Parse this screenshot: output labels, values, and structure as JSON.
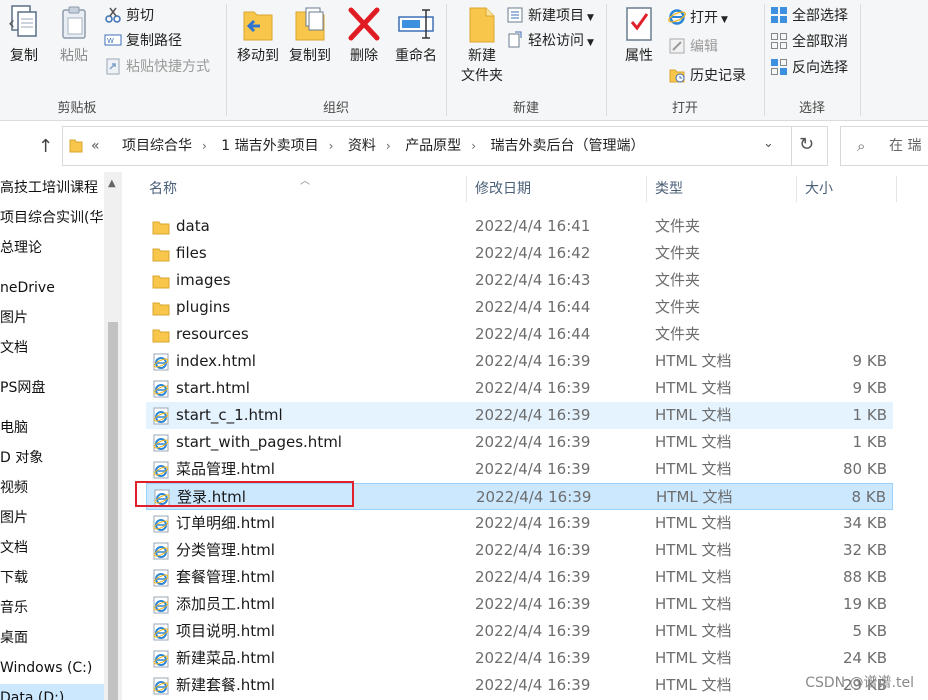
{
  "ribbon": {
    "clipboard": {
      "label": "剪贴板",
      "copy": "复制",
      "paste": "粘贴",
      "cut": "剪切",
      "copy_path": "复制路径",
      "paste_shortcut": "粘贴快捷方式"
    },
    "organize": {
      "label": "组织",
      "move_to": "移动到",
      "copy_to": "复制到",
      "delete": "删除",
      "rename": "重命名"
    },
    "new": {
      "label": "新建",
      "new_folder_1": "新建",
      "new_folder_2": "文件夹",
      "new_item": "新建项目",
      "easy_access": "轻松访问"
    },
    "open": {
      "label": "打开",
      "properties": "属性",
      "open": "打开",
      "edit": "编辑",
      "history": "历史记录"
    },
    "select": {
      "label": "选择",
      "select_all": "全部选择",
      "select_none": "全部取消",
      "invert": "反向选择"
    }
  },
  "address": {
    "overflow": "«",
    "crumbs": [
      "项目综合华",
      "1 瑞吉外卖项目",
      "资料",
      "产品原型",
      "瑞吉外卖后台（管理端）"
    ],
    "search_placeholder": "在 瑞"
  },
  "nav": {
    "items": [
      "高技工培训课程",
      "项目综合实训(华",
      "总理论",
      "neDrive",
      "图片",
      "文档",
      "PS网盘",
      "电脑",
      "D 对象",
      "视频",
      "图片",
      "文档",
      "下载",
      "音乐",
      "桌面",
      "Windows (C:)",
      "Data (D:)"
    ]
  },
  "columns": {
    "name": "名称",
    "date": "修改日期",
    "type": "类型",
    "size": "大小"
  },
  "files": [
    {
      "name": "data",
      "date": "2022/4/4 16:41",
      "type": "文件夹",
      "size": "",
      "kind": "folder"
    },
    {
      "name": "files",
      "date": "2022/4/4 16:42",
      "type": "文件夹",
      "size": "",
      "kind": "folder"
    },
    {
      "name": "images",
      "date": "2022/4/4 16:43",
      "type": "文件夹",
      "size": "",
      "kind": "folder"
    },
    {
      "name": "plugins",
      "date": "2022/4/4 16:44",
      "type": "文件夹",
      "size": "",
      "kind": "folder"
    },
    {
      "name": "resources",
      "date": "2022/4/4 16:44",
      "type": "文件夹",
      "size": "",
      "kind": "folder"
    },
    {
      "name": "index.html",
      "date": "2022/4/4 16:39",
      "type": "HTML 文档",
      "size": "9 KB",
      "kind": "html"
    },
    {
      "name": "start.html",
      "date": "2022/4/4 16:39",
      "type": "HTML 文档",
      "size": "9 KB",
      "kind": "html"
    },
    {
      "name": "start_c_1.html",
      "date": "2022/4/4 16:39",
      "type": "HTML 文档",
      "size": "1 KB",
      "kind": "html",
      "state": "hover"
    },
    {
      "name": "start_with_pages.html",
      "date": "2022/4/4 16:39",
      "type": "HTML 文档",
      "size": "1 KB",
      "kind": "html"
    },
    {
      "name": "菜品管理.html",
      "date": "2022/4/4 16:39",
      "type": "HTML 文档",
      "size": "80 KB",
      "kind": "html"
    },
    {
      "name": "登录.html",
      "date": "2022/4/4 16:39",
      "type": "HTML 文档",
      "size": "8 KB",
      "kind": "html",
      "state": "selected"
    },
    {
      "name": "订单明细.html",
      "date": "2022/4/4 16:39",
      "type": "HTML 文档",
      "size": "34 KB",
      "kind": "html"
    },
    {
      "name": "分类管理.html",
      "date": "2022/4/4 16:39",
      "type": "HTML 文档",
      "size": "32 KB",
      "kind": "html"
    },
    {
      "name": "套餐管理.html",
      "date": "2022/4/4 16:39",
      "type": "HTML 文档",
      "size": "88 KB",
      "kind": "html"
    },
    {
      "name": "添加员工.html",
      "date": "2022/4/4 16:39",
      "type": "HTML 文档",
      "size": "19 KB",
      "kind": "html"
    },
    {
      "name": "项目说明.html",
      "date": "2022/4/4 16:39",
      "type": "HTML 文档",
      "size": "5 KB",
      "kind": "html"
    },
    {
      "name": "新建菜品.html",
      "date": "2022/4/4 16:39",
      "type": "HTML 文档",
      "size": "24 KB",
      "kind": "html"
    },
    {
      "name": "新建套餐.html",
      "date": "2022/4/4 16:39",
      "type": "HTML 文档",
      "size": "29 KB",
      "kind": "html"
    }
  ],
  "watermark": "CSDN @谱谱.tel",
  "colors": {
    "selection": "#cce8ff",
    "hover": "#e5f3ff",
    "highlight_box": "#e0202a",
    "folder": "#f8c64b"
  }
}
